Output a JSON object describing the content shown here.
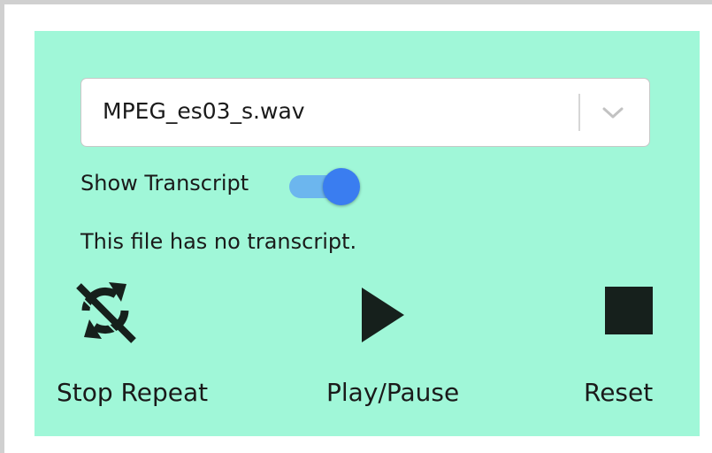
{
  "file_select": {
    "selected": "MPEG_es03_s.wav",
    "icon": "chevron-down-icon"
  },
  "transcript_toggle": {
    "label": "Show Transcript",
    "enabled": true,
    "track_color": "#6cb6ee",
    "knob_color": "#3a7df0"
  },
  "transcript_message": "This file has no transcript.",
  "controls": {
    "repeat": {
      "label": "Stop Repeat",
      "icon": "repeat-off-icon"
    },
    "play": {
      "label": "Play/Pause",
      "icon": "play-icon"
    },
    "reset": {
      "label": "Reset",
      "icon": "stop-icon"
    }
  },
  "colors": {
    "panel_background": "#a0f7d8",
    "icon_color": "#16201c"
  }
}
